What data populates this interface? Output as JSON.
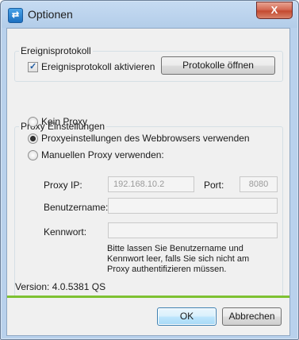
{
  "window": {
    "title": "Optionen",
    "close_label": "X",
    "app_icon_glyph": "⇄"
  },
  "event_log": {
    "group_title": "Ereignisprotokoll",
    "enable_label": "Ereignisprotokoll aktivieren",
    "enable_checked": true,
    "open_button": "Protokolle öffnen"
  },
  "proxy": {
    "group_title": "Proxy Einstellungen",
    "options": [
      {
        "label": "Kein Proxy",
        "selected": false
      },
      {
        "label": "Proxyeinstellungen des Webbrowsers verwenden",
        "selected": true
      },
      {
        "label": "Manuellen Proxy verwenden:",
        "selected": false
      }
    ],
    "ip_label": "Proxy IP:",
    "ip_value": "192.168.10.2",
    "port_label": "Port:",
    "port_value": "8080",
    "username_label": "Benutzername:",
    "username_value": "",
    "password_label": "Kennwort:",
    "password_value": "",
    "hint_lines": [
      "Bitte lassen Sie Benutzername und",
      "Kennwort leer, falls Sie sich nicht am",
      "Proxy authentifizieren müssen."
    ]
  },
  "version_text": "Version: 4.0.5381 QS",
  "buttons": {
    "ok": "OK",
    "cancel": "Abbrechen"
  },
  "colors": {
    "accent_green": "#7ec132",
    "title_bar": "#b9d1ec",
    "close_red": "#c44a30"
  }
}
